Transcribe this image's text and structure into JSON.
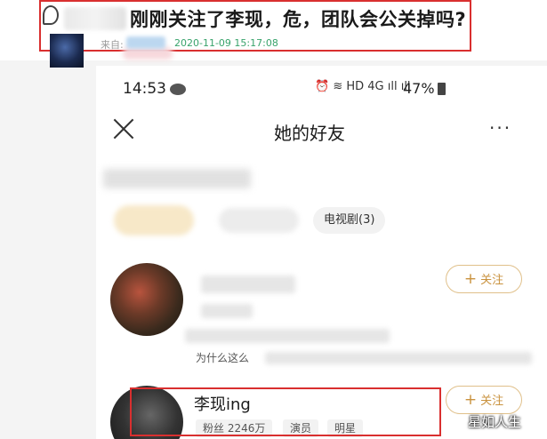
{
  "post": {
    "headline": "刚刚关注了李现，危，团队会公关掉吗?",
    "source_label": "来自:",
    "timestamp": "2020-11-09 15:17:08"
  },
  "statusbar": {
    "time": "14:53",
    "indicators": "⏰ ≋ HD 4G ıll ıll",
    "battery": "47%"
  },
  "nav": {
    "title": "她的好友",
    "more": "···"
  },
  "filters": {
    "chip": "电视剧(3)"
  },
  "users": [
    {
      "follow_label": "关注",
      "snippet": "为什么这么"
    },
    {
      "name": "李现ing",
      "fans": "粉丝 2246万",
      "tag1": "演员",
      "tag2": "明星",
      "follow_label": "关注"
    }
  ],
  "watermark": "星如人生",
  "colors": {
    "highlight_box": "#d92f2f",
    "follow_accent": "#c9923e",
    "timestamp": "#38a36b"
  }
}
